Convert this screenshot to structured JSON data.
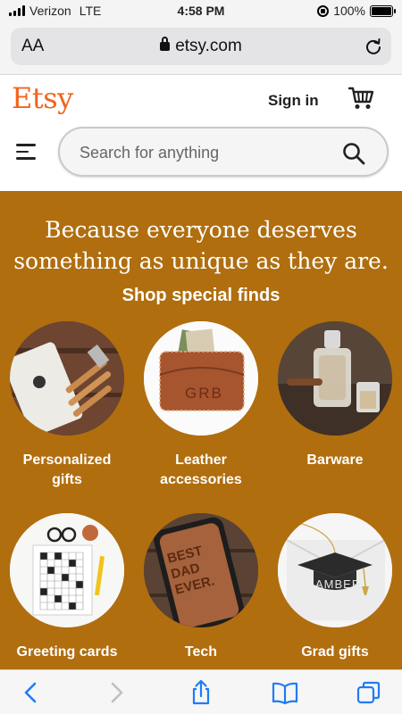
{
  "status_bar": {
    "carrier": "Verizon",
    "network": "LTE",
    "time": "4:58 PM",
    "battery": "100%",
    "battery_level": 1.0
  },
  "browser": {
    "text_size_label": "AA",
    "url": "etsy.com"
  },
  "header": {
    "logo": "Etsy",
    "sign_in": "Sign in",
    "search_placeholder": "Search for anything"
  },
  "hero": {
    "headline_line1": "Because everyone deserves",
    "headline_line2": "something as unique as they are.",
    "subheading": "Shop special finds",
    "background_color": "#b06e0f",
    "categories": [
      {
        "label_line1": "Personalized",
        "label_line2": "gifts",
        "icon": "bbq-tools-photo"
      },
      {
        "label_line1": "Leather",
        "label_line2": "accessories",
        "icon": "leather-wallet-photo"
      },
      {
        "label_line1": "Barware",
        "label_line2": "",
        "icon": "decanter-photo"
      },
      {
        "label_line1": "Greeting cards",
        "label_line2": "",
        "icon": "crossword-card-photo"
      },
      {
        "label_line1": "Tech",
        "label_line2": "",
        "icon": "phone-case-photo"
      },
      {
        "label_line1": "Grad gifts",
        "label_line2": "",
        "icon": "grad-cap-ornament-photo"
      }
    ]
  },
  "colors": {
    "brand": "#f1641e",
    "hero_bg": "#b06e0f",
    "ios_blue": "#1f7cf4"
  }
}
